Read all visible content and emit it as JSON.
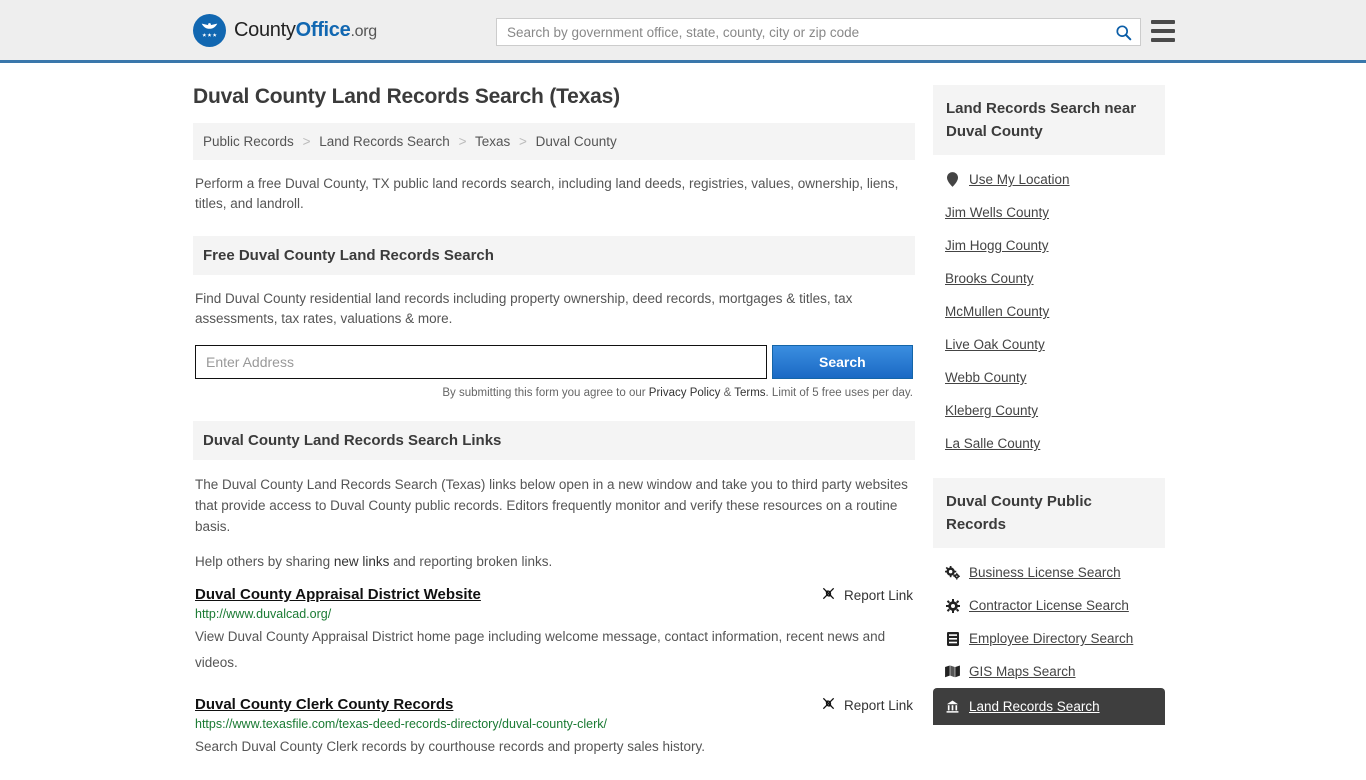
{
  "header": {
    "logo": {
      "part1": "County",
      "part2": "Office",
      "part3": ".org",
      "icon": "eagle-seal-icon"
    },
    "search_placeholder": "Search by government office, state, county, city or zip code",
    "search_value": "",
    "search_icon": "search-icon",
    "menu_icon": "hamburger-menu-icon"
  },
  "main": {
    "title": "Duval County Land Records Search (Texas)",
    "breadcrumb": [
      {
        "label": "Public Records"
      },
      {
        "label": "Land Records Search"
      },
      {
        "label": "Texas"
      },
      {
        "label": "Duval County"
      }
    ],
    "breadcrumb_separator": ">",
    "intro": "Perform a free Duval County, TX public land records search, including land deeds, registries, values, ownership, liens, titles, and landroll.",
    "free_search": {
      "heading": "Free Duval County Land Records Search",
      "description": "Find Duval County residential land records including property ownership, deed records, mortgages & titles, tax assessments, tax rates, valuations & more.",
      "input_placeholder": "Enter Address",
      "input_value": "",
      "button_label": "Search",
      "legal_prefix": "By submitting this form you agree to our ",
      "legal_privacy": "Privacy Policy",
      "legal_amp": " & ",
      "legal_terms": "Terms",
      "legal_suffix": ". Limit of 5 free uses per day."
    },
    "links_section": {
      "heading": "Duval County Land Records Search Links",
      "paragraph": "The Duval County Land Records Search (Texas) links below open in a new window and take you to third party websites that provide access to Duval County public records. Editors frequently monitor and verify these resources on a routine basis.",
      "help_prefix": "Help others by sharing ",
      "help_link": "new links",
      "help_suffix": " and reporting broken links.",
      "report_label": "Report Link",
      "report_icon": "broken-link-icon",
      "items": [
        {
          "title": "Duval County Appraisal District Website",
          "url": "http://www.duvalcad.org/",
          "description": "View Duval County Appraisal District home page including welcome message, contact information, recent news and videos."
        },
        {
          "title": "Duval County Clerk County Records",
          "url": "https://www.texasfile.com/texas-deed-records-directory/duval-county-clerk/",
          "description": "Search Duval County Clerk records by courthouse records and property sales history."
        }
      ]
    }
  },
  "sidebar": {
    "nearby": {
      "heading": "Land Records Search near Duval County",
      "items": [
        {
          "label": "Use My Location",
          "icon": "map-pin-icon"
        },
        {
          "label": "Jim Wells County",
          "icon": ""
        },
        {
          "label": "Jim Hogg County",
          "icon": ""
        },
        {
          "label": "Brooks County",
          "icon": ""
        },
        {
          "label": "McMullen County",
          "icon": ""
        },
        {
          "label": "Live Oak County",
          "icon": ""
        },
        {
          "label": "Webb County",
          "icon": ""
        },
        {
          "label": "Kleberg County",
          "icon": ""
        },
        {
          "label": "La Salle County",
          "icon": ""
        }
      ]
    },
    "public_records": {
      "heading": "Duval County Public Records",
      "items": [
        {
          "label": "Business License Search",
          "icon": "cogs-icon",
          "active": false
        },
        {
          "label": "Contractor License Search",
          "icon": "gear-icon",
          "active": false
        },
        {
          "label": "Employee Directory Search",
          "icon": "id-card-icon",
          "active": false
        },
        {
          "label": "GIS Maps Search",
          "icon": "map-icon",
          "active": false
        },
        {
          "label": "Land Records Search",
          "icon": "landmark-icon",
          "active": true
        }
      ]
    }
  },
  "colors": {
    "brand_blue": "#1167b1",
    "header_bg": "#eeeeee",
    "header_border": "#3a77ab",
    "panel_bg": "#f4f4f4",
    "link_url_green": "#1a7a33",
    "highlight_dark": "#3e3e3e"
  }
}
